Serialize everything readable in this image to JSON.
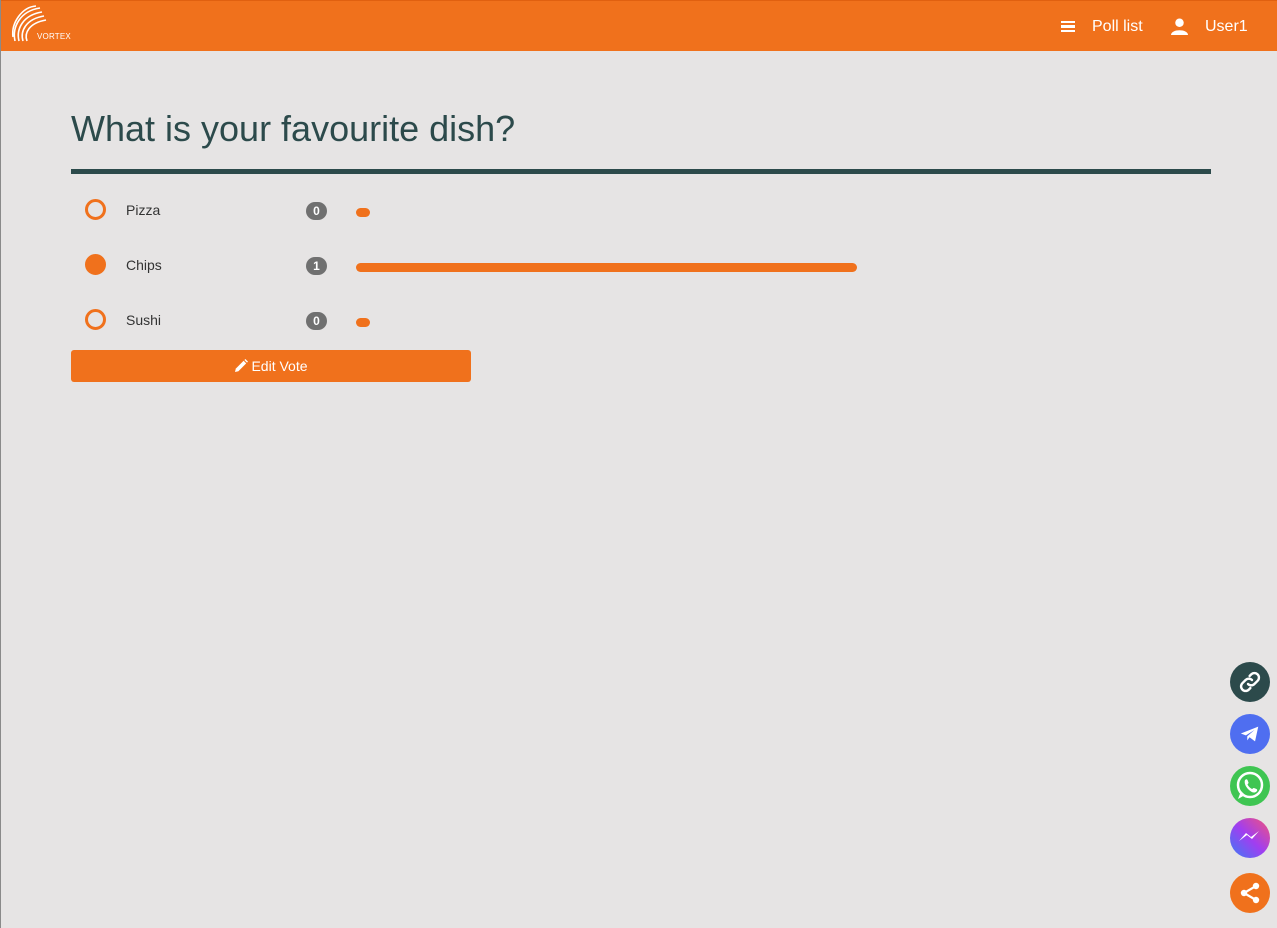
{
  "header": {
    "logo_text": "VORTEX",
    "poll_list_label": "Poll list",
    "user_label": "User1"
  },
  "poll": {
    "question": "What is your favourite dish?",
    "total_votes": 1,
    "options": [
      {
        "label": "Pizza",
        "votes": "0",
        "selected": false,
        "fraction": 0
      },
      {
        "label": "Chips",
        "votes": "1",
        "selected": true,
        "fraction": 1
      },
      {
        "label": "Sushi",
        "votes": "0",
        "selected": false,
        "fraction": 0
      }
    ],
    "edit_button_label": "Edit Vote"
  },
  "share_buttons": [
    {
      "icon": "link-icon",
      "color": "#2c4a4b"
    },
    {
      "icon": "telegram-icon",
      "color": "#4f6ef0"
    },
    {
      "icon": "whatsapp-icon",
      "color": "#3fc552"
    },
    {
      "icon": "messenger-icon",
      "color": "#a061e8"
    },
    {
      "icon": "share-icon",
      "color": "#f0711c"
    }
  ],
  "colors": {
    "accent": "#f0711c",
    "title": "#2c4a4b",
    "background": "#e6e4e4",
    "badge": "#707070"
  }
}
